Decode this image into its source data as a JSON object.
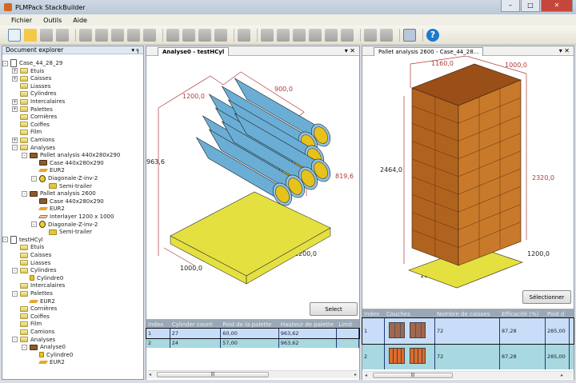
{
  "app": {
    "title": "PLMPack StackBuilder"
  },
  "menu": [
    "Fichier",
    "Outils",
    "Aide"
  ],
  "explorer": {
    "title": "Document explorer",
    "pin": "▾ ╕",
    "nodes": [
      {
        "label": "Case_44_28_29",
        "level": 0,
        "icon": "document-icon",
        "pm": "-"
      },
      {
        "label": "Etuis",
        "level": 1,
        "icon": "folder-icon",
        "pm": "+"
      },
      {
        "label": "Caisses",
        "level": 1,
        "icon": "folder-icon",
        "pm": "+"
      },
      {
        "label": "Liasses",
        "level": 1,
        "icon": "folder-icon"
      },
      {
        "label": "Cylindres",
        "level": 1,
        "icon": "folder-icon"
      },
      {
        "label": "Intercalaires",
        "level": 1,
        "icon": "folder-icon",
        "pm": "+"
      },
      {
        "label": "Palettes",
        "level": 1,
        "icon": "folder-icon",
        "pm": "+"
      },
      {
        "label": "Cornières",
        "level": 1,
        "icon": "folder-icon"
      },
      {
        "label": "Coiffes",
        "level": 1,
        "icon": "folder-icon"
      },
      {
        "label": "Film",
        "level": 1,
        "icon": "folder-icon"
      },
      {
        "label": "Camions",
        "level": 1,
        "icon": "folder-icon",
        "pm": "+"
      },
      {
        "label": "Analyses",
        "level": 1,
        "icon": "folder-icon",
        "pm": "-"
      },
      {
        "label": "Pallet analysis 440x280x290",
        "level": 2,
        "icon": "analysis-icon",
        "pm": "-"
      },
      {
        "label": "Case 440x280x290",
        "level": 3,
        "icon": "case-icon"
      },
      {
        "label": "EUR2",
        "level": 3,
        "icon": "pallet-icon"
      },
      {
        "label": "Diagonale-Z-inv-2",
        "level": 3,
        "icon": "bulb-icon",
        "pm": "-"
      },
      {
        "label": "Semi-trailer",
        "level": 4,
        "icon": "truck-icon"
      },
      {
        "label": "Pallet analysis 2600",
        "level": 2,
        "icon": "analysis-icon",
        "pm": "-"
      },
      {
        "label": "Case 440x280x290",
        "level": 3,
        "icon": "case-icon"
      },
      {
        "label": "EUR2",
        "level": 3,
        "icon": "pallet-icon"
      },
      {
        "label": "Interlayer 1200 x 1000",
        "level": 3,
        "icon": "interlayer-icon"
      },
      {
        "label": "Diagonale-Z-inv-2",
        "level": 3,
        "icon": "bulb-icon",
        "pm": "-"
      },
      {
        "label": "Semi-trailer",
        "level": 4,
        "icon": "truck-icon"
      },
      {
        "label": "testHCyl",
        "level": 0,
        "icon": "document-icon",
        "pm": "-"
      },
      {
        "label": "Etuis",
        "level": 1,
        "icon": "folder-icon"
      },
      {
        "label": "Caisses",
        "level": 1,
        "icon": "folder-icon"
      },
      {
        "label": "Liasses",
        "level": 1,
        "icon": "folder-icon"
      },
      {
        "label": "Cylindres",
        "level": 1,
        "icon": "folder-icon",
        "pm": "-"
      },
      {
        "label": "Cylindre0",
        "level": 2,
        "icon": "cylinder-icon"
      },
      {
        "label": "Intercalaires",
        "level": 1,
        "icon": "folder-icon"
      },
      {
        "label": "Palettes",
        "level": 1,
        "icon": "folder-icon",
        "pm": "-"
      },
      {
        "label": "EUR2",
        "level": 2,
        "icon": "pallet-icon"
      },
      {
        "label": "Cornières",
        "level": 1,
        "icon": "folder-icon"
      },
      {
        "label": "Coiffes",
        "level": 1,
        "icon": "folder-icon"
      },
      {
        "label": "Film",
        "level": 1,
        "icon": "folder-icon"
      },
      {
        "label": "Camions",
        "level": 1,
        "icon": "folder-icon"
      },
      {
        "label": "Analyses",
        "level": 1,
        "icon": "folder-icon",
        "pm": "-"
      },
      {
        "label": "Analyse0",
        "level": 2,
        "icon": "analysis-icon",
        "pm": "-"
      },
      {
        "label": "Cylindre0",
        "level": 3,
        "icon": "cylinder-icon"
      },
      {
        "label": "EUR2",
        "level": 3,
        "icon": "pallet-icon"
      }
    ]
  },
  "analysis_cyl": {
    "tab": "Analyse0 - testHCyl",
    "tab_controls": "▾ ✕",
    "dims": {
      "length": "1200,0",
      "width": "900,0",
      "height": "963,6",
      "height2": "819,6",
      "pallet_w": "1000,0",
      "pallet_l": "1200,0"
    },
    "select_label": "Select",
    "columns": [
      "Index",
      "Cylinder count",
      "Poid de la palette",
      "Hauteur de palette",
      "Limit"
    ],
    "rows": [
      [
        "1",
        "27",
        "60,00",
        "963,62",
        ""
      ],
      [
        "2",
        "24",
        "57,00",
        "963,62",
        ""
      ]
    ]
  },
  "analysis_pallet": {
    "tab": "Pallet analysis 2600 - Case_44_28...",
    "tab_controls": "▾ ✕",
    "dims": {
      "top_l": "1160,0",
      "top_w": "1000,0",
      "height": "2464,0",
      "height2": "2320,0",
      "pallet_w": "1000,0",
      "pallet_l": "1200,0"
    },
    "select_label": "Sélectionner",
    "columns": [
      "Index",
      "Couches",
      "Nombre de caisses",
      "Efficacité (%)",
      "Poid d"
    ],
    "rows": [
      [
        "1",
        "",
        "72",
        "87,28",
        "285,00"
      ],
      [
        "2",
        "",
        "72",
        "87,28",
        "285,00"
      ]
    ]
  },
  "colors": {
    "cylinder": "#6aaed6",
    "cylinder_core": "#e6c21a",
    "pallet": "#e4e040",
    "case": "#a0581e",
    "dim": "#b03a3a",
    "row_selected": "#c8def8",
    "row_alt": "#a8d8e0"
  }
}
